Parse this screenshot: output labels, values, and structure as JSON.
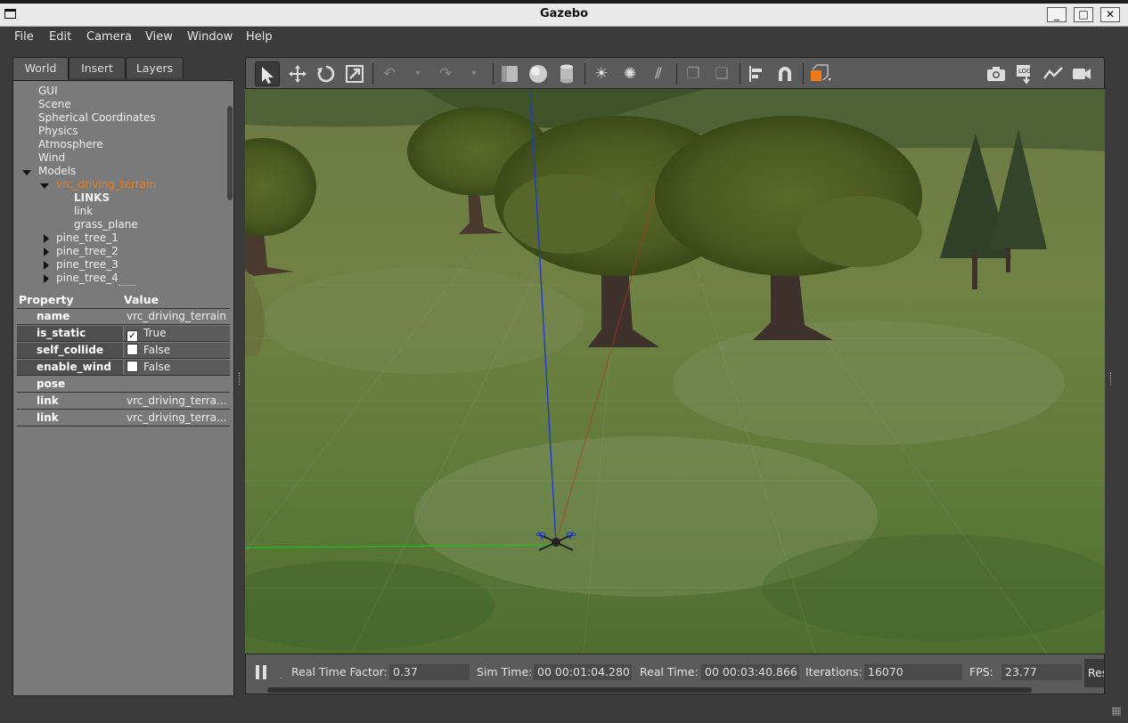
{
  "window": {
    "title": "Gazebo",
    "controls": {
      "minimize": "_",
      "maximize": "□",
      "close": "✕"
    }
  },
  "menu": [
    "File",
    "Edit",
    "Camera",
    "View",
    "Window",
    "Help"
  ],
  "left_panel": {
    "tabs": [
      "World",
      "Insert",
      "Layers"
    ],
    "active_tab": "World",
    "tree": {
      "top_items": [
        "GUI",
        "Scene",
        "Spherical Coordinates",
        "Physics",
        "Atmosphere",
        "Wind"
      ],
      "models_label": "Models",
      "selected_model": "vrc_driving_terrain",
      "links_header": "LINKS",
      "links": [
        "link",
        "grass_plane"
      ],
      "other_models": [
        "pine_tree_1",
        "pine_tree_2",
        "pine_tree_3",
        "pine_tree_4"
      ]
    },
    "properties": {
      "headers": {
        "property": "Property",
        "value": "Value"
      },
      "rows": [
        {
          "name": "name",
          "value": "vrc_driving_terrain"
        },
        {
          "name": "is_static",
          "value": "True",
          "checked": true
        },
        {
          "name": "self_collide",
          "value": "False",
          "checked": false
        },
        {
          "name": "enable_wind",
          "value": "False",
          "checked": false
        },
        {
          "name": "pose",
          "value": ""
        },
        {
          "name": "link",
          "value": "vrc_driving_terra..."
        },
        {
          "name": "link",
          "value": "vrc_driving_terra..."
        }
      ]
    }
  },
  "toolbar": {
    "icons": [
      "select-mode-icon",
      "translate-mode-icon",
      "rotate-mode-icon",
      "scale-mode-icon",
      "undo-icon",
      "undo-history-icon",
      "redo-icon",
      "redo-history-icon",
      "box-shape-icon",
      "sphere-shape-icon",
      "cylinder-shape-icon",
      "point-light-icon",
      "spot-light-icon",
      "directional-light-icon",
      "copy-icon",
      "paste-icon",
      "align-icon",
      "snap-icon",
      "view-angle-icon",
      "screenshot-icon",
      "log-icon",
      "plot-icon",
      "video-record-icon"
    ]
  },
  "status": {
    "real_time_factor_label": "Real Time Factor:",
    "real_time_factor": "0.37",
    "sim_time_label": "Sim Time:",
    "sim_time": "00 00:01:04.280",
    "real_time_label": "Real Time:",
    "real_time": "00 00:03:40.866",
    "iterations_label": "Iterations:",
    "iterations": "16070",
    "fps_label": "FPS:",
    "fps": "23.77",
    "reset_label": "Reset"
  },
  "colors": {
    "selected_tree_item": "#f07a1a",
    "panel_bg": "#7a7a7a",
    "toolbar_bg": "#5a5a5a",
    "z_axis": "#1e3cc8",
    "y_axis": "#20c020",
    "x_axis": "#c03020"
  }
}
